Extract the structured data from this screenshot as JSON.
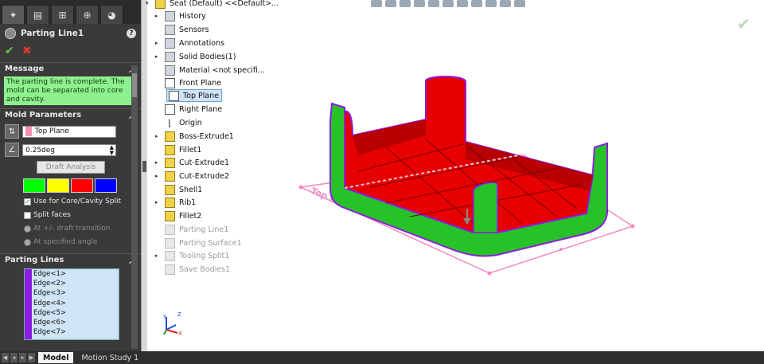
{
  "property_manager": {
    "title": "Parting Line1",
    "help": "?",
    "ok": "✔",
    "cancel": "✖",
    "tabs": [
      "✦",
      "▤",
      "⊞",
      "⊕",
      "◕"
    ],
    "message": {
      "header": "Message",
      "text": "The parting line is complete. The mold can be separated into core and cavity."
    },
    "mold_parameters": {
      "header": "Mold Parameters",
      "direction_reference": "Top Plane",
      "draft_angle": "0.25deg",
      "draft_analysis_button": "Draft Analysis",
      "colors": [
        "#00ff00",
        "#ffff00",
        "#ff0000",
        "#0000ff"
      ],
      "use_core_cavity_split": "Use for Core/Cavity Split",
      "split_faces": "Split faces",
      "at_draft_transition": "At +/- draft transition",
      "at_specified_angle": "At specified angle"
    },
    "parting_lines": {
      "header": "Parting Lines",
      "edges": [
        "Edge<1>",
        "Edge<2>",
        "Edge<3>",
        "Edge<4>",
        "Edge<5>",
        "Edge<6>",
        "Edge<7>"
      ]
    }
  },
  "feature_tree": {
    "root": "Seat (Default) <<Default>...",
    "items": [
      {
        "label": "History",
        "expand": "▸"
      },
      {
        "label": "Sensors",
        "expand": ""
      },
      {
        "label": "Annotations",
        "expand": "▸"
      },
      {
        "label": "Solid Bodies(1)",
        "expand": "▸"
      },
      {
        "label": "Material <not specifi...",
        "expand": ""
      },
      {
        "label": "Front Plane",
        "expand": ""
      },
      {
        "label": "Top Plane",
        "expand": ""
      },
      {
        "label": "Right Plane",
        "expand": ""
      },
      {
        "label": "Origin",
        "expand": ""
      },
      {
        "label": "Boss-Extrude1",
        "expand": "▸"
      },
      {
        "label": "Fillet1",
        "expand": ""
      },
      {
        "label": "Cut-Extrude1",
        "expand": "▸"
      },
      {
        "label": "Cut-Extrude2",
        "expand": "▸"
      },
      {
        "label": "Shell1",
        "expand": ""
      },
      {
        "label": "Rib1",
        "expand": "▸"
      },
      {
        "label": "Fillet2",
        "expand": ""
      },
      {
        "label": "Parting Line1",
        "expand": ""
      },
      {
        "label": "Parting Surface1",
        "expand": ""
      },
      {
        "label": "Tooling Split1",
        "expand": "▸"
      },
      {
        "label": "Save Bodies1",
        "expand": ""
      }
    ]
  },
  "viewport": {
    "plane_label": "Top Plane",
    "confirm_corner": "✔",
    "triad": {
      "x": "X",
      "y": "Y",
      "z": "Z"
    }
  },
  "bottom_tabs": {
    "model": "Model",
    "motion_study": "Motion Study 1"
  },
  "colors": {
    "cavity_red": "#e60000",
    "core_green": "#27c227",
    "parting_purple": "#8b1ce0",
    "plane_pink": "#f28ac0",
    "message_green": "#8ff08f"
  }
}
